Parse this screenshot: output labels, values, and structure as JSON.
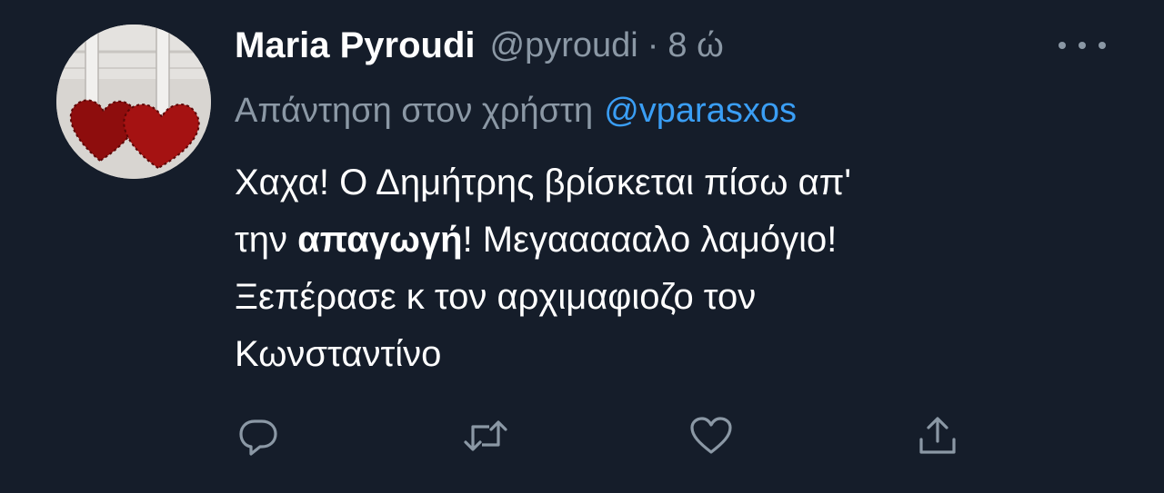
{
  "tweet": {
    "author_name": "Maria Pyroudi",
    "author_handle": "@pyroudi",
    "separator": "·",
    "time_ago": "8 ώ",
    "reply_prefix": "Απάντηση στον χρήστη",
    "reply_to": "@vparasxos",
    "body": {
      "line1": "Χαχα! Ο Δημήτρης βρίσκεται πίσω απ'",
      "line2_pre": "την ",
      "line2_bold": "απαγωγή",
      "line2_post": "! Μεγαααααλο λαμόγιο!",
      "line3": "Ξεπέρασε κ τον αρχιμαφιοζο τον",
      "line4": "Κωνσταντίνο"
    }
  },
  "icons": {
    "more": "more-horizontal-icon",
    "reply": "reply-bubble-icon",
    "retweet": "retweet-icon",
    "like": "heart-icon",
    "share": "share-icon"
  },
  "colors": {
    "background": "#151d2a",
    "text_primary": "#ffffff",
    "text_secondary": "#8b98a5",
    "link": "#3a9ef5"
  }
}
